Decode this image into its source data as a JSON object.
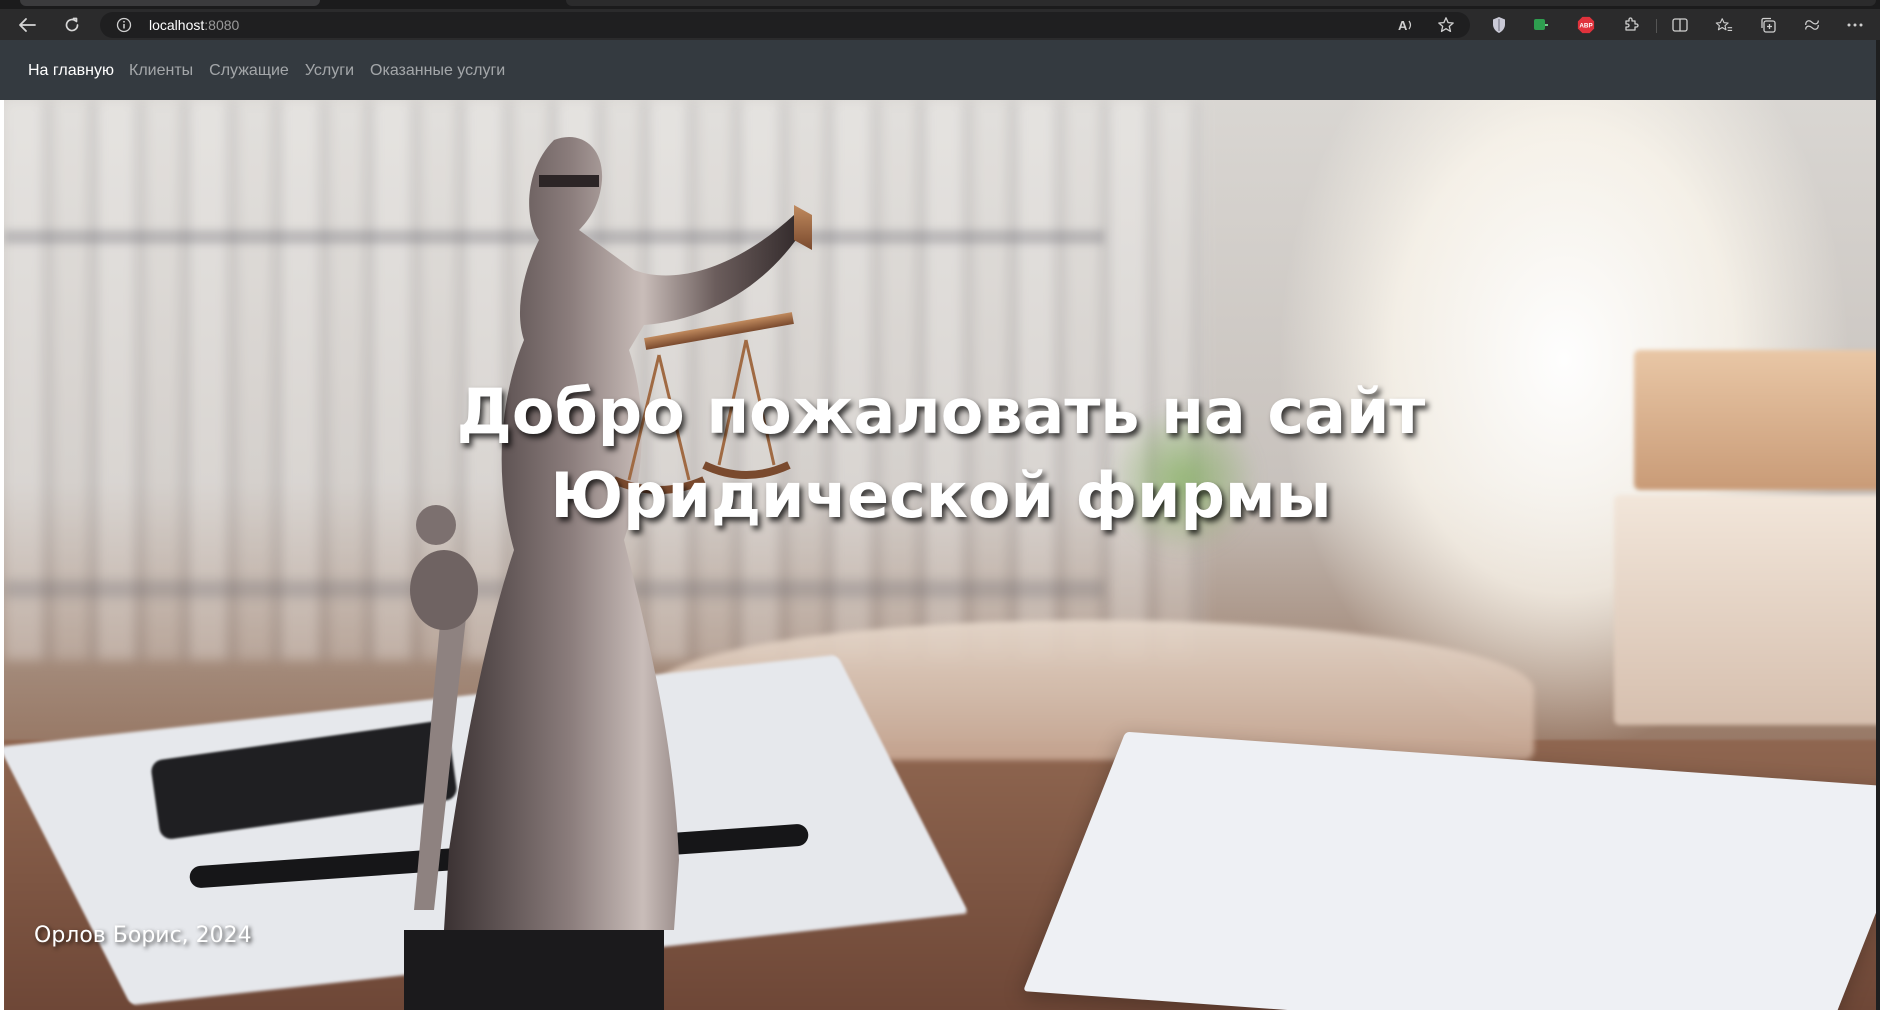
{
  "browser": {
    "url_host": "localhost",
    "url_port": ":8080",
    "icons": [
      "back-icon",
      "reload-icon",
      "site-info-icon",
      "read-aloud-icon",
      "favorite-star-icon",
      "shield-extension-icon",
      "green-extension-icon",
      "adblock-extension-icon",
      "extensions-puzzle-icon",
      "split-screen-icon",
      "favorites-icon",
      "collections-icon",
      "copilot-icon",
      "more-menu-icon"
    ],
    "adblock_label": "ABP"
  },
  "navbar": {
    "brand": "На главную",
    "links": [
      "Клиенты",
      "Служащие",
      "Услуги",
      "Оказанные услуги"
    ],
    "colors": {
      "background": "#343a40",
      "link": "rgba(255,255,255,0.55)",
      "active": "#ffffff"
    }
  },
  "hero": {
    "title_line1": "Добро пожаловать на сайт",
    "title_line2": "Юридической фирмы",
    "background_subject": "justice-statue-photo"
  },
  "footer": {
    "text": "Орлов Борис, 2024"
  }
}
